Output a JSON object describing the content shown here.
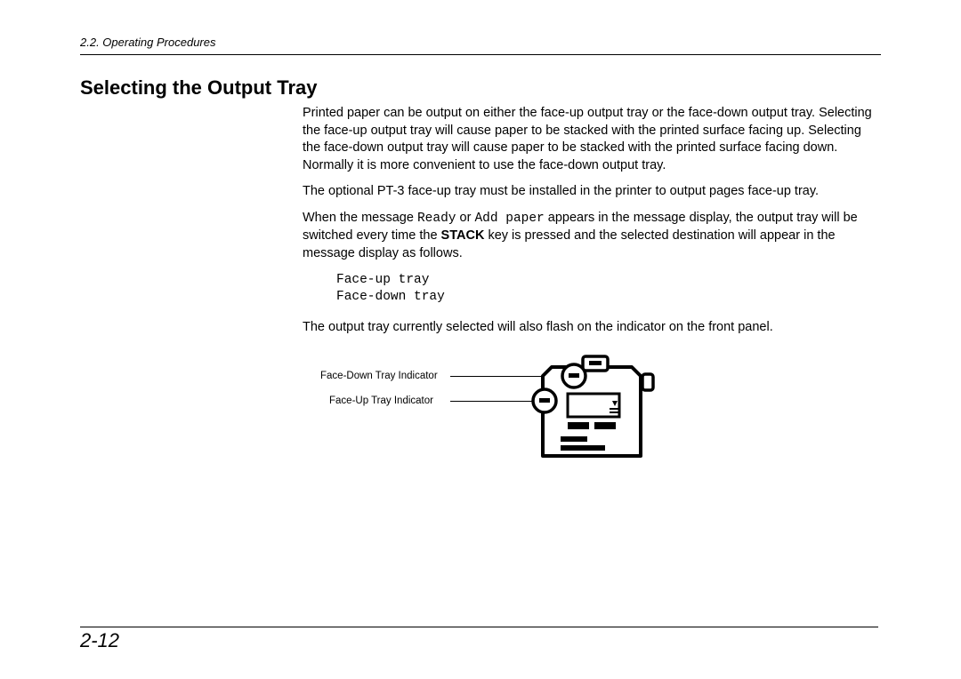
{
  "header": {
    "section_ref": "2.2. Operating Procedures"
  },
  "title": "Selecting the Output Tray",
  "body": {
    "p1": "Printed paper can be output on either the face-up output tray or the face-down output tray. Selecting the face-up output tray will cause paper to be stacked with the printed surface facing up. Selecting the face-down output tray will cause paper to be stacked with the printed surface facing down.  Normally it is more convenient to use the face-down output tray.",
    "p2": "The optional PT-3 face-up tray must be installed in the printer to output pages face-up tray.",
    "p3_pre": "When the message ",
    "p3_mono1": "Ready",
    "p3_mid1": " or ",
    "p3_mono2": "Add paper",
    "p3_mid2": " appears in the message display, the output tray will be switched every time the ",
    "p3_bold": "STACK",
    "p3_post": " key is pressed and the selected destination will appear in the message display as follows.",
    "display": "Face-up tray\nFace-down tray",
    "p4": "The output tray currently selected will also flash on the indicator on the front panel."
  },
  "figure": {
    "label_top": "Face-Down Tray Indicator",
    "label_bottom": "Face-Up Tray Indicator"
  },
  "page_number": "2-12"
}
